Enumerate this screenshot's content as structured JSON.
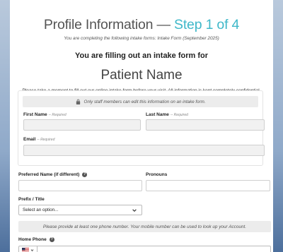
{
  "header": {
    "title_main": "Profile Information — ",
    "title_step": "Step 1 of 4",
    "subtitle": "You are completing the following intake forms: Intake Form (September 2025)",
    "filling_text": "You are filling out an intake form for",
    "patient_name": "Patient Name",
    "note": "Please take a moment to fill out our online intake form before your visit. All information is kept completely confidential."
  },
  "panel": {
    "staff_notice": "Only staff members can edit this information on an intake form.",
    "first_name_label": "First Name",
    "last_name_label": "Last Name",
    "email_label": "Email",
    "required_text": "-- Required"
  },
  "form": {
    "preferred_name_label": "Preferred Name (if different)",
    "pronouns_label": "Pronouns",
    "prefix_label": "Prefix / Title",
    "prefix_select_value": "Select an option...",
    "phone_note": "Please provide at least one phone number. Your mobile number can be used to look up your Account.",
    "home_phone_label": "Home Phone",
    "help_glyph": "?"
  },
  "colors": {
    "accent": "#3fb8c9",
    "background": "#8fa9c9"
  },
  "icons": [
    "lock-icon",
    "help-icon",
    "chevron-down-icon",
    "us-flag-icon"
  ]
}
